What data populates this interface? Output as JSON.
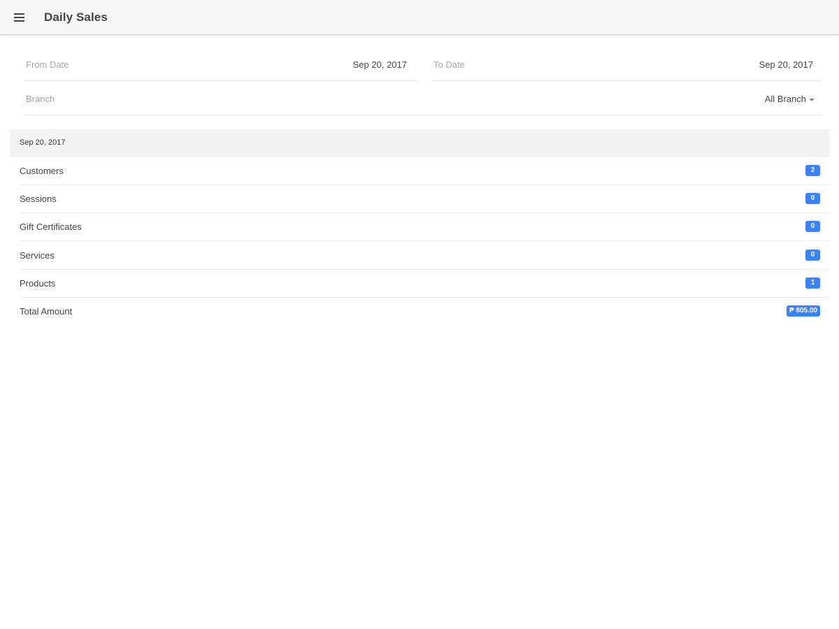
{
  "app": {
    "title": "Daily Sales"
  },
  "icons": {
    "menu": "hamburger-menu-icon",
    "dropdown": "caret-down-icon"
  },
  "colors": {
    "badge": "#3b82f6",
    "toolbar": "#f7f7f7",
    "section_header": "#f4f4f4"
  },
  "filters": {
    "from_date": {
      "label": "From Date",
      "value": "Sep 20, 2017"
    },
    "to_date": {
      "label": "To Date",
      "value": "Sep 20, 2017"
    },
    "branch": {
      "label": "Branch",
      "value": "All Branch"
    }
  },
  "report": {
    "date": "Sep 20, 2017",
    "rows": [
      {
        "label": "Customers",
        "value": "2"
      },
      {
        "label": "Sessions",
        "value": "0"
      },
      {
        "label": "Gift Certificates",
        "value": "0"
      },
      {
        "label": "Services",
        "value": "0"
      },
      {
        "label": "Products",
        "value": "1"
      },
      {
        "label": "Total Amount",
        "value": "₱ 805.00"
      }
    ]
  }
}
